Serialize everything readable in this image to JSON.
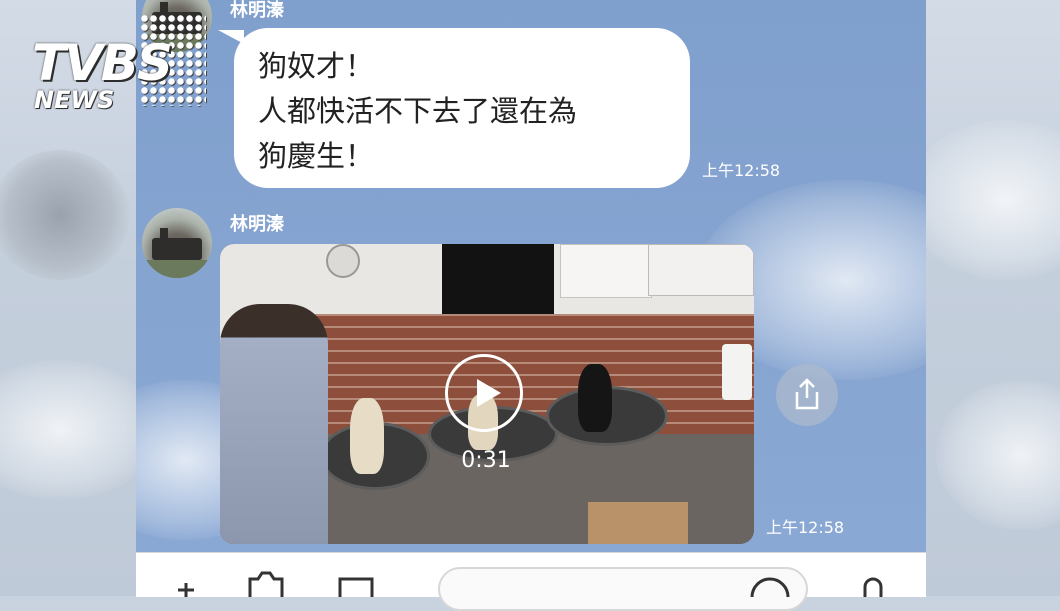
{
  "watermark": {
    "brand": "TVBS",
    "sub": "NEWS"
  },
  "chat": {
    "messages": [
      {
        "type": "text",
        "sender": "林明溱",
        "lines": [
          "狗奴才！",
          "人都快活不下去了還在為",
          "狗慶生！"
        ],
        "time": "上午12:58"
      },
      {
        "type": "video",
        "sender": "林明溱",
        "duration": "0:31",
        "time": "上午12:58"
      }
    ]
  },
  "icons": {
    "play": "play-icon",
    "share": "share-icon",
    "add": "plus-icon",
    "camera": "camera-icon",
    "photo": "image-icon",
    "emoji": "emoji-icon",
    "mic": "microphone-icon"
  },
  "colors": {
    "chat_background": "#86a4d0",
    "bubble": "#ffffff",
    "text": "#222222"
  }
}
